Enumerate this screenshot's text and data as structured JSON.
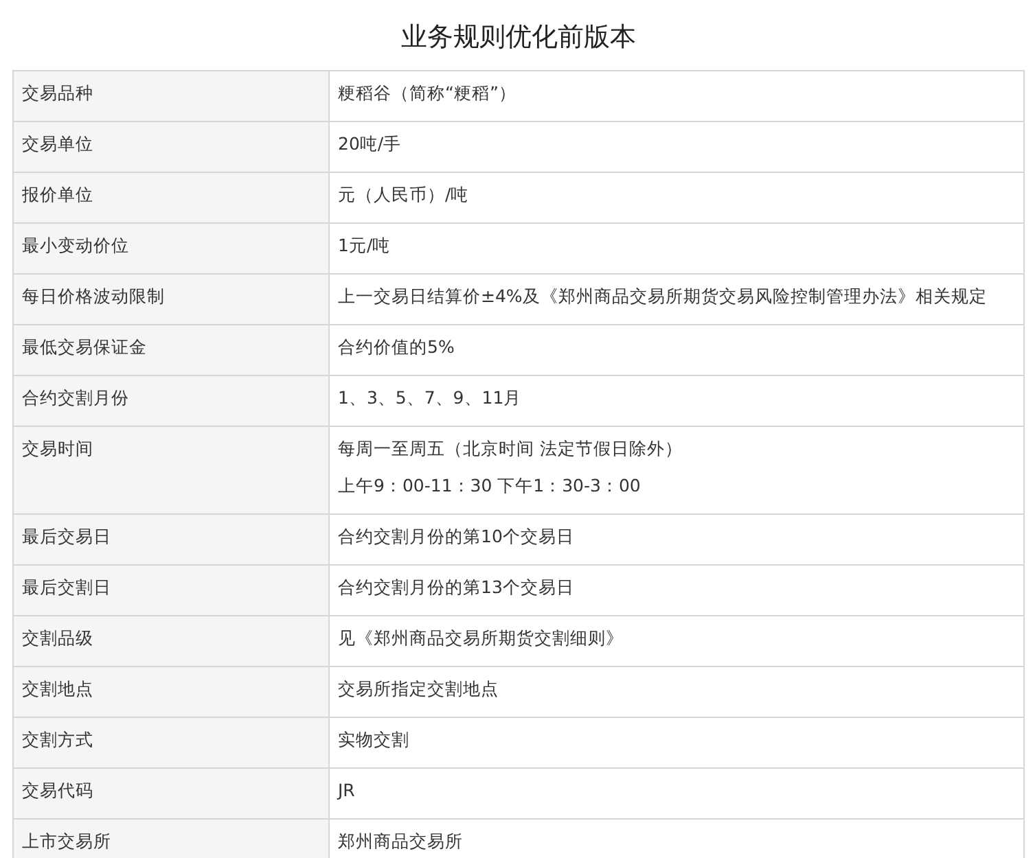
{
  "title": "业务规则优化前版本",
  "rows": [
    {
      "label": "交易品种",
      "lines": [
        "粳稻谷（简称“粳稻”）"
      ]
    },
    {
      "label": "交易单位",
      "lines": [
        "20吨/手"
      ]
    },
    {
      "label": "报价单位",
      "lines": [
        "元（人民币）/吨"
      ]
    },
    {
      "label": "最小变动价位",
      "lines": [
        "1元/吨"
      ]
    },
    {
      "label": "每日价格波动限制",
      "lines": [
        "上一交易日结算价±4%及《郑州商品交易所期货交易风险控制管理办法》相关规定"
      ]
    },
    {
      "label": "最低交易保证金",
      "lines": [
        "合约价值的5%"
      ]
    },
    {
      "label": "合约交割月份",
      "lines": [
        "1、3、5、7、9、11月"
      ]
    },
    {
      "label": "交易时间",
      "lines": [
        "每周一至周五（北京时间 法定节假日除外）",
        "上午9：00-11：30 下午1：30-3：00"
      ]
    },
    {
      "label": "最后交易日",
      "lines": [
        "合约交割月份的第10个交易日"
      ]
    },
    {
      "label": "最后交割日",
      "lines": [
        "合约交割月份的第13个交易日"
      ]
    },
    {
      "label": "交割品级",
      "lines": [
        "见《郑州商品交易所期货交割细则》"
      ]
    },
    {
      "label": "交割地点",
      "lines": [
        "交易所指定交割地点"
      ]
    },
    {
      "label": "交割方式",
      "lines": [
        "实物交割"
      ]
    },
    {
      "label": "交易代码",
      "lines": [
        "JR"
      ]
    },
    {
      "label": "上市交易所",
      "lines": [
        "郑州商品交易所"
      ]
    }
  ]
}
